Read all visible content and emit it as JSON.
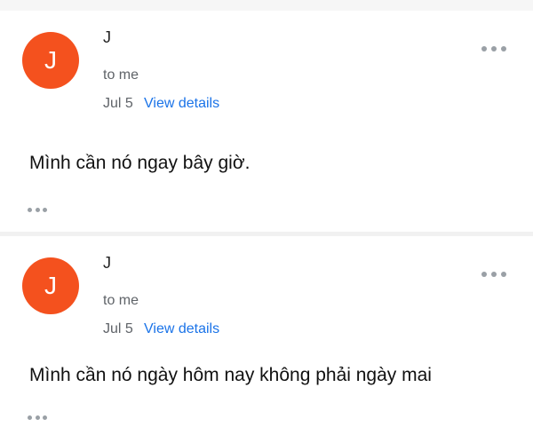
{
  "messages": [
    {
      "avatar_letter": "J",
      "sender": "J",
      "to": "to me",
      "date": "Jul 5",
      "details_link": "View details",
      "body": "Mình cần nó ngay bây giờ."
    },
    {
      "avatar_letter": "J",
      "sender": "J",
      "to": "to me",
      "date": "Jul 5",
      "details_link": "View details",
      "body": "Mình cần nó ngày hôm nay không phải ngày mai"
    }
  ],
  "colors": {
    "avatar": "#f4511e",
    "link": "#1a73e8",
    "meta": "#5f6368"
  },
  "icons": {
    "more": "more-horizontal-icon",
    "expand": "ellipsis-icon"
  }
}
